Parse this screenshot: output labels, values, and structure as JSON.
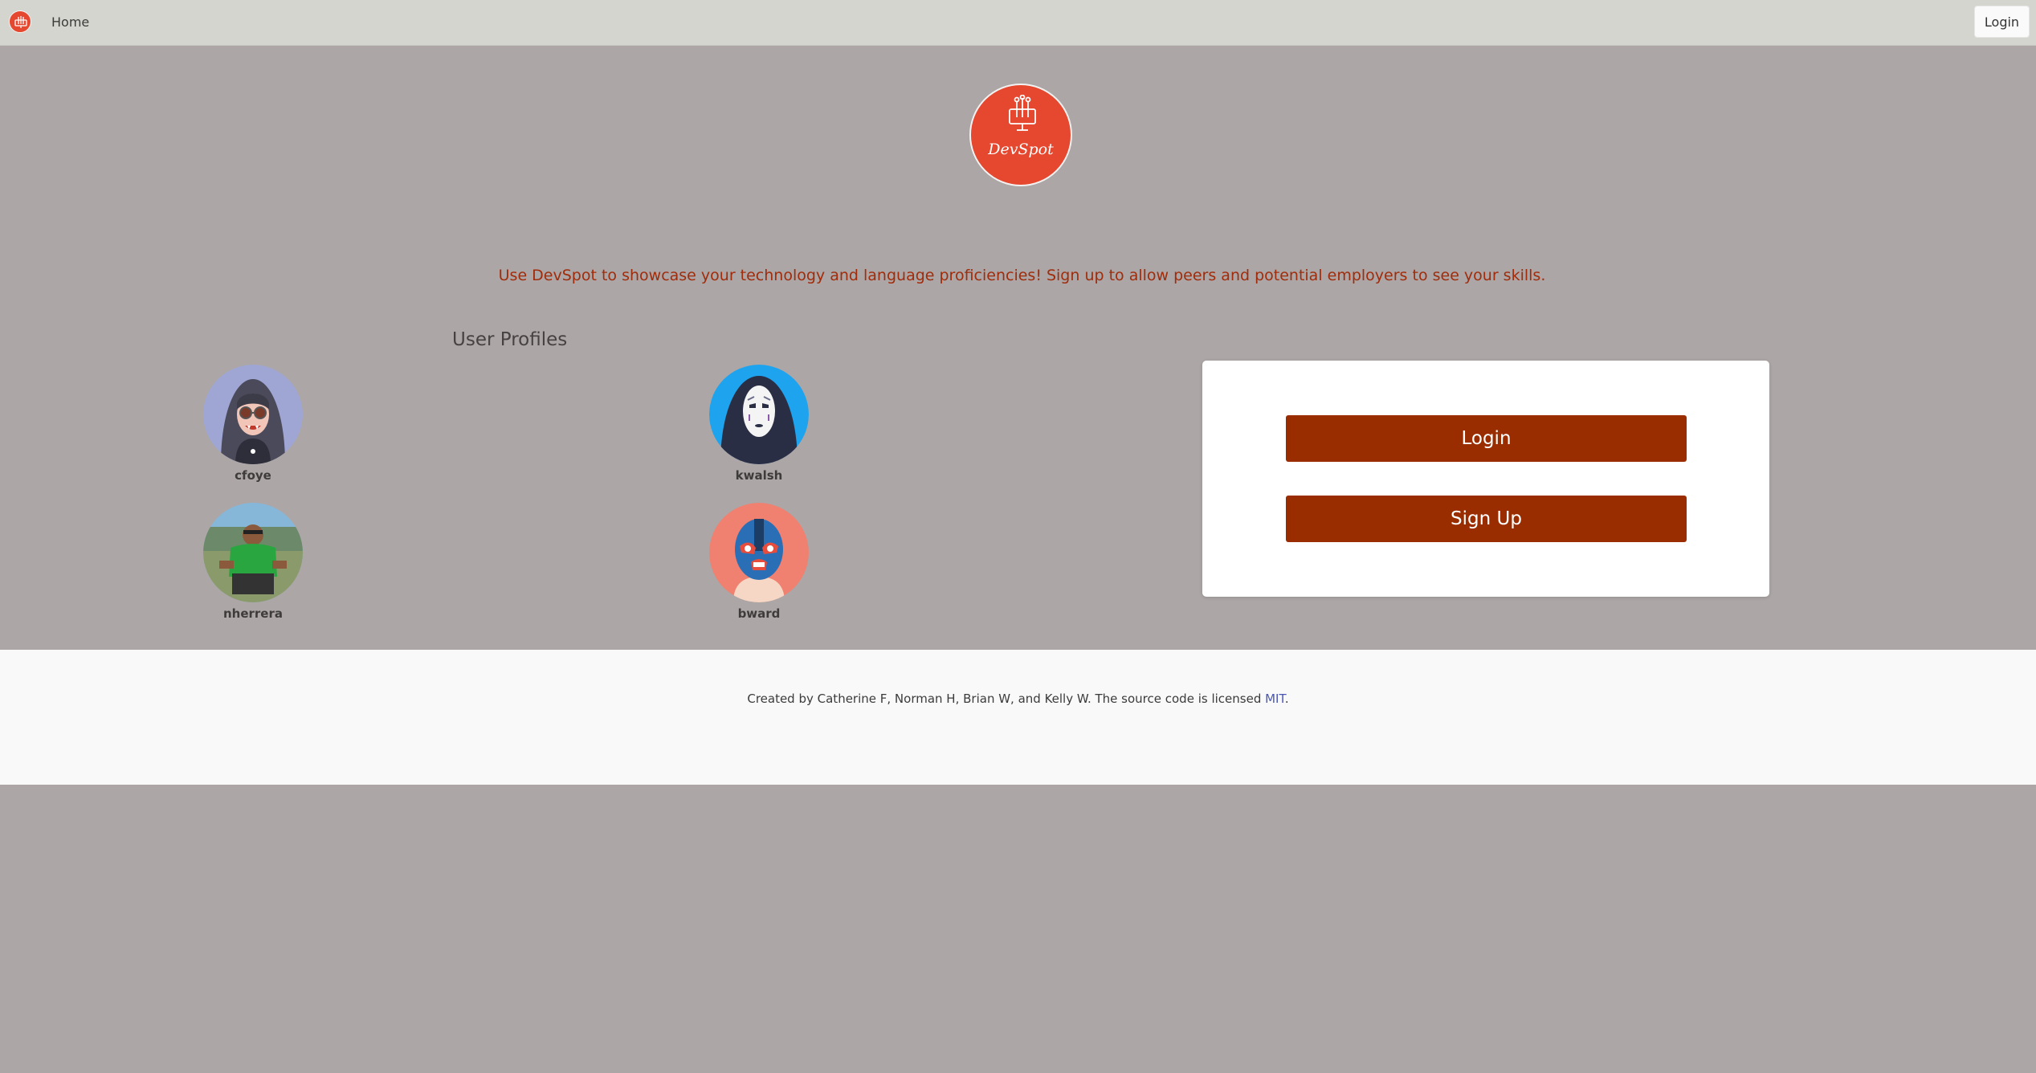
{
  "navbar": {
    "logo_icon": "devspot-logo-icon",
    "home_label": "Home",
    "login_label": "Login"
  },
  "brand": {
    "name": "DevSpot",
    "color": "#e5472f"
  },
  "tagline": "Use DevSpot to showcase your technology and language proficiencies! Sign up to allow peers and potential employers to see your skills.",
  "profiles": {
    "heading": "User Profiles",
    "users": [
      {
        "username": "cfoye",
        "avatar": "vampire-hoodie-avatar"
      },
      {
        "username": "kwalsh",
        "avatar": "no-face-mask-avatar"
      },
      {
        "username": "nherrera",
        "avatar": "photo-avatar"
      },
      {
        "username": "bward",
        "avatar": "luchador-mask-avatar"
      }
    ]
  },
  "auth_card": {
    "login_label": "Login",
    "signup_label": "Sign Up",
    "button_color": "#9a2d00"
  },
  "footer": {
    "text": "Created by Catherine F, Norman H, Brian W, and Kelly W. The source code is licensed ",
    "link_label": "MIT",
    "suffix": "."
  }
}
